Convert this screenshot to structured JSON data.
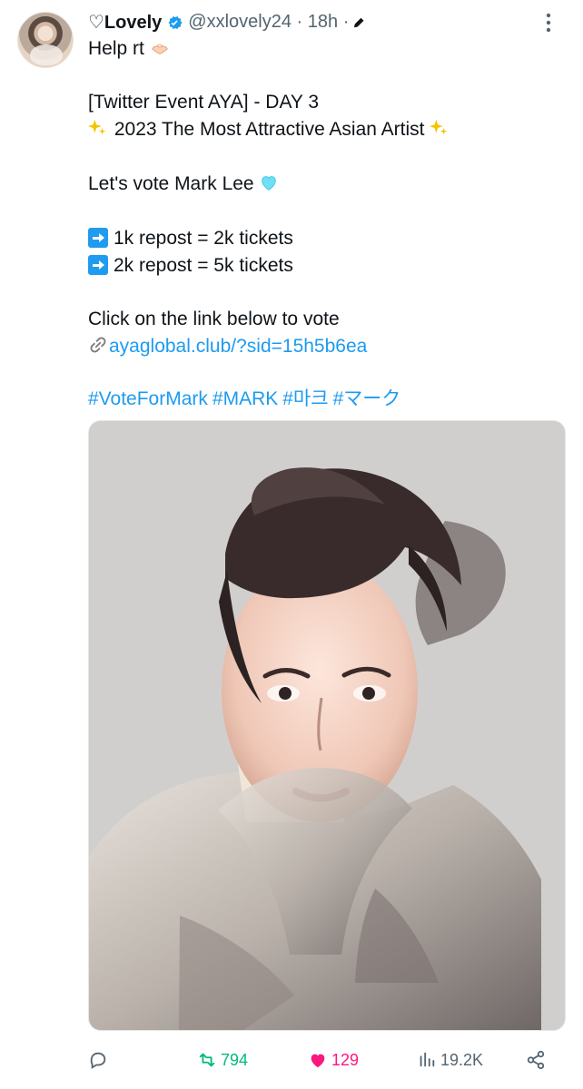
{
  "tweet": {
    "display_name": "♡Lovely",
    "handle": "@xxlovely24",
    "time": "· 18h ·",
    "lines": {
      "l1": "Help rt",
      "l2": "[Twitter Event AYA] - DAY 3",
      "l3": "2023 The Most Attractive Asian Artist",
      "l4": "Let's vote Mark Lee",
      "l5": "1k repost = 2k tickets",
      "l6": "2k repost = 5k tickets",
      "l7": "Click on the link below to vote",
      "link": "ayaglobal.club/?sid=15h5b6ea"
    },
    "hashtags": [
      "#VoteForMark",
      "#MARK",
      "#마크",
      "#マーク"
    ],
    "stats": {
      "retweets": "794",
      "likes": "129",
      "views": "19.2K"
    },
    "icons": {
      "verified": "verified-badge-icon",
      "edit": "edit-icon",
      "more": "more-options-icon",
      "reply": "reply-icon",
      "retweet": "retweet-icon",
      "like": "heart-icon",
      "views": "views-icon",
      "share": "share-icon"
    },
    "colors": {
      "link": "#1d9bf0",
      "retweet": "#00ba7c",
      "like": "#f91880",
      "muted": "#536471"
    }
  }
}
